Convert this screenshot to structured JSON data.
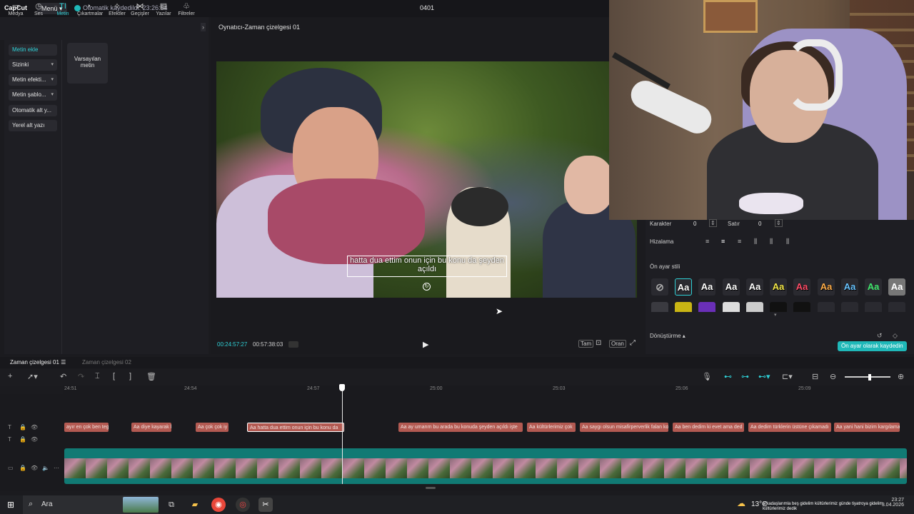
{
  "app": {
    "logo": "CapCut",
    "menu_label": "Menü",
    "autosave_text": "Otomatik kaydedildi: 23:26:54",
    "project_title": "0401"
  },
  "toolbar": [
    {
      "label": "Medya",
      "icon": "▭"
    },
    {
      "label": "Ses",
      "icon": "◷"
    },
    {
      "label": "Metin",
      "icon": "TI"
    },
    {
      "label": "Çıkartmalar",
      "icon": "◔"
    },
    {
      "label": "Efektler",
      "icon": "✧"
    },
    {
      "label": "Geçişler",
      "icon": "⋈"
    },
    {
      "label": "Yazılar",
      "icon": "▤"
    },
    {
      "label": "Filtreler",
      "icon": "♧"
    }
  ],
  "text_panel": {
    "items": [
      "Metin ekle",
      "Sizinki",
      "Metin efekti...",
      "Metin şablo...",
      "Otomatik alt y...",
      "Yerel alt yazı"
    ],
    "default_card": "Varsayılan metin"
  },
  "player": {
    "title": "Oynatıcı-Zaman çizelgesi 01",
    "caption": "hatta dua ettim onun için bu konu da şeyden açıldı",
    "time_current": "00:24:57:27",
    "time_total": "00:57:38:03",
    "controls": [
      "Tam",
      "Oran"
    ]
  },
  "props": {
    "karakter_label": "Karakter",
    "karakter_value": "0",
    "satir_label": "Satır",
    "satir_value": "0",
    "hizalama_label": "Hizalama",
    "on_ayar_label": "Ön ayar stili",
    "preset_text": "Aa",
    "preset_colors": [
      "#ffffff",
      "#ffffff",
      "#ffffff",
      "#ffffff",
      "#f5e94a",
      "#ff4f6a",
      "#ffae4a",
      "#6ac4ff",
      "#3fe36a",
      "#ffffff"
    ],
    "donusturme_label": "Dönüştürme",
    "save_button": "Ön ayar olarak kaydedin"
  },
  "timeline": {
    "tab_active": "Zaman çizelgesi 01",
    "tab_inactive": "Zaman çizelgesi 02",
    "ticks": [
      "24:51",
      "24:54",
      "24:57",
      "25:00",
      "25:03",
      "25:06",
      "25:09"
    ],
    "clips": [
      "ayır en çok ben tege",
      "Aa diye kayarak b",
      "Aa çok çok iy",
      "Aa hatta dua ettim onun için bu konu da",
      "Aa ay umarım bu arada bu konuda şeyden açıldı işte",
      "Aa kültürlerimiz çok",
      "Aa saygı olsun misafirperverlik falan ko",
      "Aa ben dedim ki evet ama ded",
      "Aa dedim türklerin üstüne çıkamadı",
      "Aa yani hani bizim kargılama"
    ]
  },
  "taskbar": {
    "search_placeholder": "Ara",
    "weather": "13°C",
    "tray_text": "arkadaşlarımla beş gidelim kültürlerimiz günde tiyatroya gidelim kültürlerimiz dedik",
    "time": "23:27",
    "date": "3.04.2026"
  }
}
